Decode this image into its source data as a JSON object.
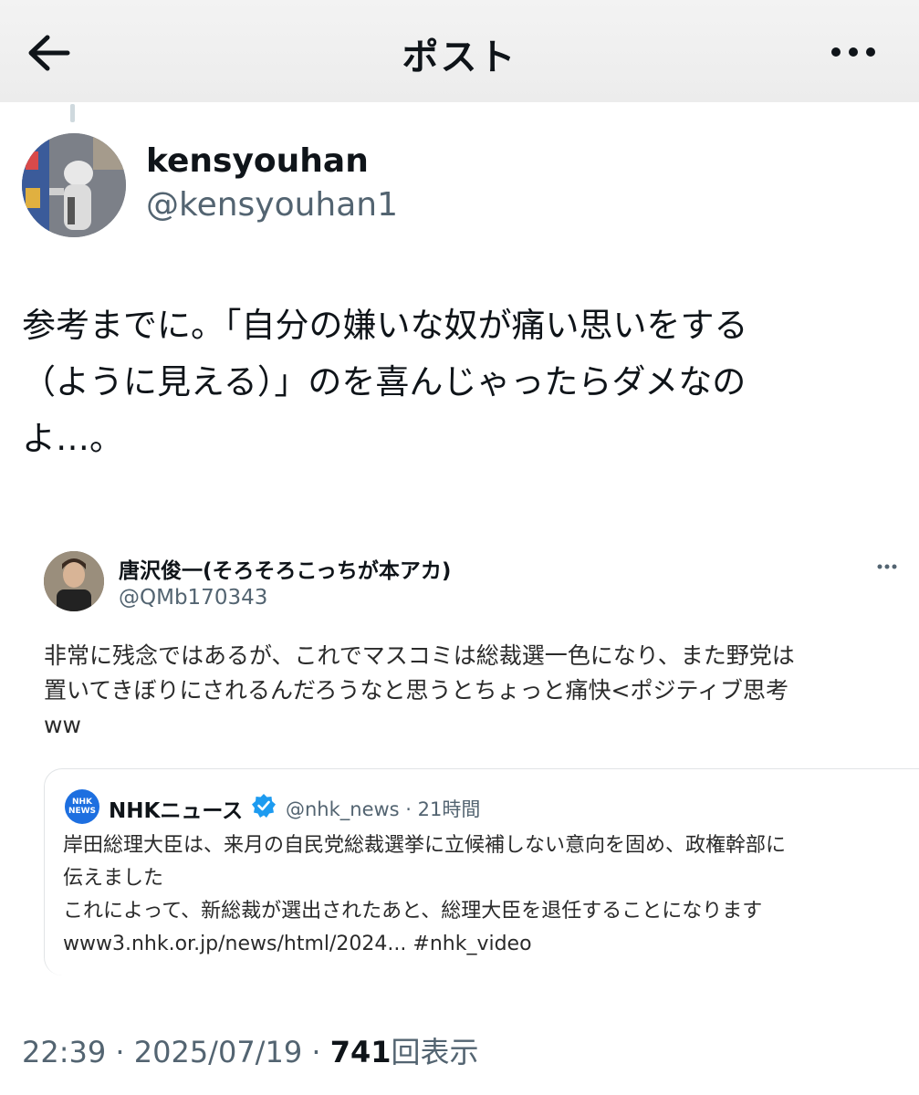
{
  "header": {
    "title": "ポスト"
  },
  "post": {
    "display_name": "kensyouhan",
    "handle": "@kensyouhan1",
    "text_lines": [
      "参考までに。「自分の嫌いな奴が痛い思いをする",
      "（ように見える）」のを喜んじゃったらダメなの",
      "よ…。"
    ]
  },
  "quoted": {
    "display_name": "唐沢俊一(そろそろこっちが本アカ)",
    "handle": "@QMb170343",
    "text_lines": [
      "非常に残念ではあるが、これでマスコミは総裁選一色になり、また野党は",
      "置いてきぼりにされるんだろうなと思うとちょっと痛快<ポジティブ思考",
      "ww"
    ],
    "card": {
      "logo_text_top": "NHK",
      "logo_text_bottom": "NEWS",
      "name": "NHKニュース",
      "meta": "@nhk_news · 21時間",
      "lines": [
        "岸田総理大臣は、来月の自民党総裁選挙に立候補しない意向を固め、政権幹部に",
        "伝えました",
        "これによって、新総裁が選出されたあと、総理大臣を退任することになります",
        "www3.nhk.or.jp/news/html/2024... #nhk_video"
      ]
    }
  },
  "footer": {
    "time": "22:39",
    "sep": " · ",
    "date": "2025/07/19",
    "views": "741",
    "views_label": "回表示"
  },
  "colors": {
    "text": "#0f1419",
    "secondary": "#536471",
    "verified": "#1d9bf0",
    "nhk": "#1d6fe0"
  }
}
